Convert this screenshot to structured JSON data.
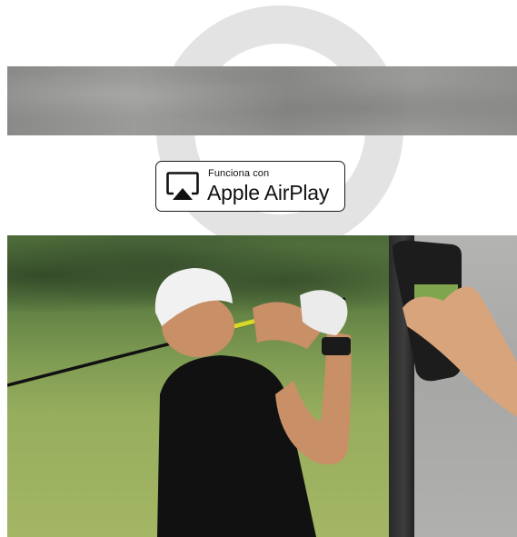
{
  "airplay_badge": {
    "small_text": "Funciona con",
    "large_text": "Apple AirPlay",
    "icon": "airplay-icon"
  },
  "photo": {
    "subject": "golfer-swinging-with-phone-mirroring"
  },
  "colors": {
    "badge_border": "#1b1b1b",
    "arc": "#e3e3e3",
    "concrete": "#969694"
  }
}
